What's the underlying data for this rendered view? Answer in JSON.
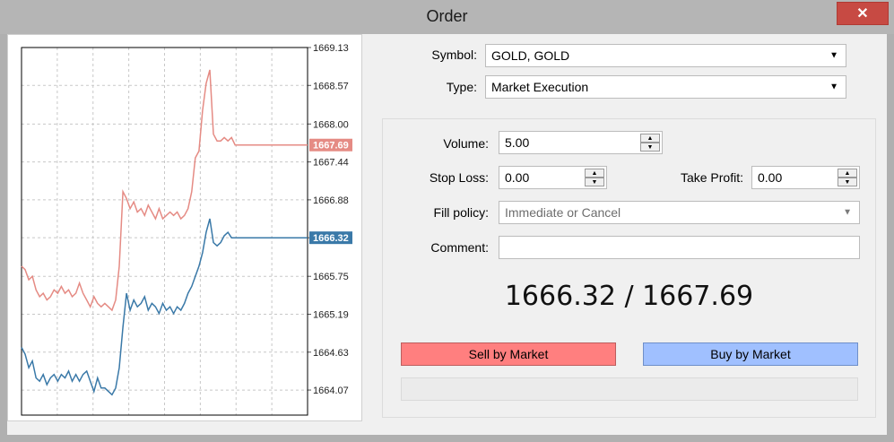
{
  "window": {
    "title": "Order",
    "close_label": "✕"
  },
  "chart_data": {
    "type": "line",
    "y_ticks": [
      "1669.13",
      "1668.57",
      "1668.00",
      "1667.44",
      "1666.88",
      "1666.32",
      "1665.75",
      "1665.19",
      "1664.63",
      "1664.07"
    ],
    "ylim": [
      1663.7,
      1669.13
    ],
    "grid": true,
    "series": [
      {
        "color": "#e58b84",
        "values": [
          1665.9,
          1665.85,
          1665.7,
          1665.75,
          1665.55,
          1665.45,
          1665.5,
          1665.4,
          1665.45,
          1665.55,
          1665.5,
          1665.6,
          1665.5,
          1665.55,
          1665.45,
          1665.5,
          1665.65,
          1665.5,
          1665.4,
          1665.3,
          1665.45,
          1665.35,
          1665.3,
          1665.35,
          1665.3,
          1665.25,
          1665.4,
          1665.9,
          1667.0,
          1666.9,
          1666.75,
          1666.85,
          1666.7,
          1666.75,
          1666.65,
          1666.8,
          1666.7,
          1666.6,
          1666.75,
          1666.6,
          1666.65,
          1666.7,
          1666.65,
          1666.7,
          1666.6,
          1666.65,
          1666.75,
          1667.0,
          1667.5,
          1667.6,
          1668.2,
          1668.6,
          1668.8,
          1667.85,
          1667.75,
          1667.75,
          1667.8,
          1667.75,
          1667.8,
          1667.69,
          1667.69,
          1667.69,
          1667.69,
          1667.69,
          1667.69,
          1667.69,
          1667.69,
          1667.69,
          1667.69,
          1667.69,
          1667.69,
          1667.69,
          1667.69,
          1667.69,
          1667.69,
          1667.69,
          1667.69,
          1667.69,
          1667.69,
          1667.69
        ],
        "last_label": "1667.69"
      },
      {
        "color": "#3a79a8",
        "values": [
          1664.7,
          1664.6,
          1664.4,
          1664.5,
          1664.25,
          1664.2,
          1664.3,
          1664.15,
          1664.25,
          1664.3,
          1664.2,
          1664.3,
          1664.25,
          1664.35,
          1664.2,
          1664.3,
          1664.2,
          1664.3,
          1664.35,
          1664.2,
          1664.05,
          1664.25,
          1664.1,
          1664.1,
          1664.05,
          1664.0,
          1664.1,
          1664.4,
          1665.0,
          1665.5,
          1665.25,
          1665.4,
          1665.3,
          1665.35,
          1665.45,
          1665.25,
          1665.35,
          1665.3,
          1665.2,
          1665.35,
          1665.25,
          1665.3,
          1665.2,
          1665.3,
          1665.25,
          1665.35,
          1665.5,
          1665.6,
          1665.75,
          1665.9,
          1666.1,
          1666.4,
          1666.6,
          1666.25,
          1666.2,
          1666.25,
          1666.35,
          1666.4,
          1666.32,
          1666.32,
          1666.32,
          1666.32,
          1666.32,
          1666.32,
          1666.32,
          1666.32,
          1666.32,
          1666.32,
          1666.32,
          1666.32,
          1666.32,
          1666.32,
          1666.32,
          1666.32,
          1666.32,
          1666.32,
          1666.32,
          1666.32,
          1666.32,
          1666.32
        ],
        "last_label": "1666.32"
      }
    ]
  },
  "form": {
    "symbol": {
      "label": "Symbol:",
      "value": "GOLD, GOLD"
    },
    "type": {
      "label": "Type:",
      "value": "Market Execution"
    },
    "volume": {
      "label": "Volume:",
      "value": "5.00"
    },
    "stop_loss": {
      "label": "Stop Loss:",
      "value": "0.00"
    },
    "take_profit": {
      "label": "Take Profit:",
      "value": "0.00"
    },
    "fill_policy": {
      "label": "Fill policy:",
      "value": "Immediate or Cancel"
    },
    "comment": {
      "label": "Comment:",
      "value": ""
    }
  },
  "quote": {
    "text": "1666.32 / 1667.69"
  },
  "buttons": {
    "sell": "Sell by Market",
    "buy": "Buy by Market"
  },
  "icons": {
    "dropdown": "▼",
    "spin_up": "▲",
    "spin_down": "▼"
  }
}
